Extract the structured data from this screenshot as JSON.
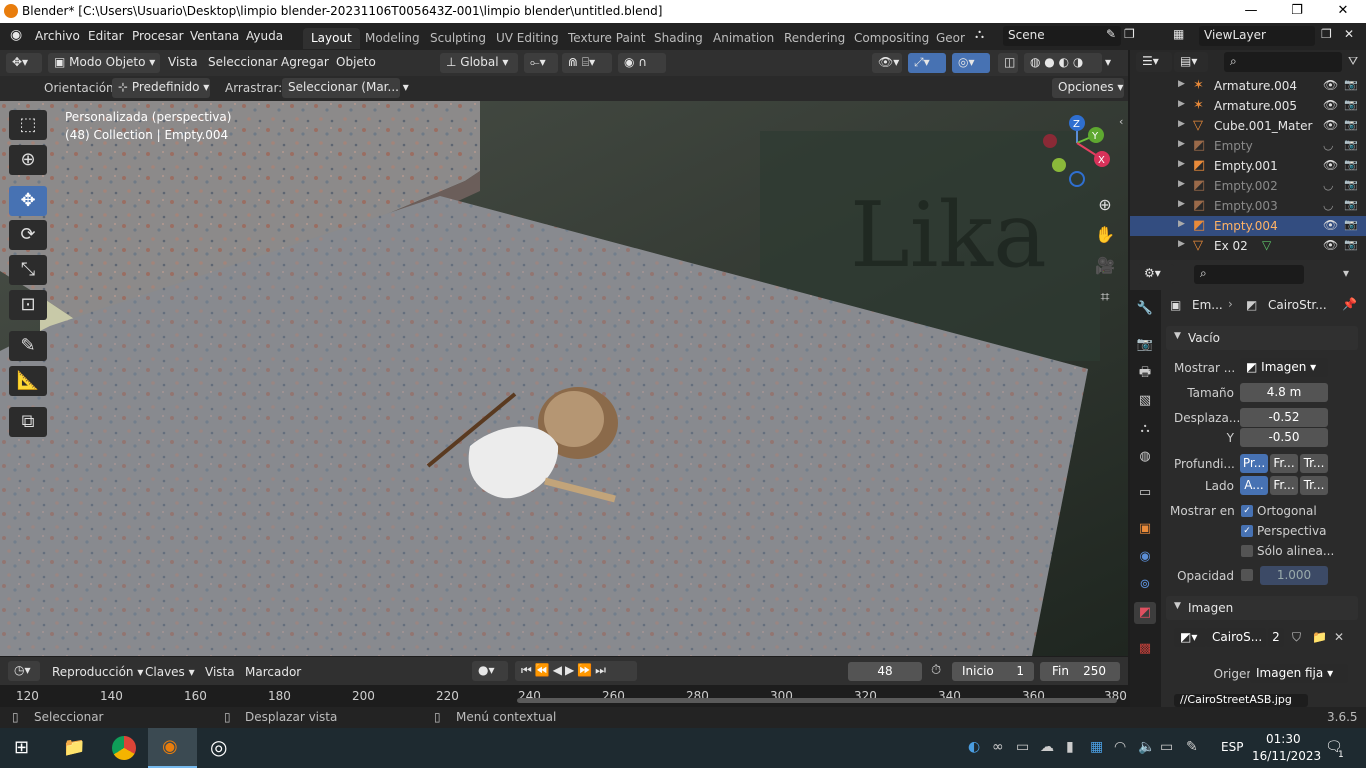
{
  "window": {
    "title": "Blender* [C:\\Users\\Usuario\\Desktop\\limpio blender-20231106T005643Z-001\\limpio blender\\untitled.blend]",
    "minimize": "—",
    "maximize": "❐",
    "close": "✕"
  },
  "menu": {
    "items": [
      "Archivo",
      "Editar",
      "Procesar",
      "Ventana",
      "Ayuda"
    ],
    "workspaces": [
      "Layout",
      "Modeling",
      "Sculpting",
      "UV Editing",
      "Texture Paint",
      "Shading",
      "Animation",
      "Rendering",
      "Compositing",
      "Geor"
    ],
    "active_workspace": "Layout",
    "scene": "Scene",
    "view_layer": "ViewLayer"
  },
  "viewport_header": {
    "mode": "Modo Objeto",
    "menus": [
      "Vista",
      "Seleccionar",
      "Agregar",
      "Objeto"
    ],
    "transform_orientation": "Global",
    "orientation_label": "Orientación:",
    "orientation_value": "Predefinido",
    "drag_label": "Arrastrar:",
    "drag_value": "Seleccionar (Mar...",
    "options": "Opciones"
  },
  "viewport": {
    "view_name": "Personalizada (perspectiva)",
    "collection_info": "(48) Collection | Empty.004",
    "gizmo_axes": [
      "Z",
      "Y",
      "X"
    ]
  },
  "outliner": {
    "search_placeholder": "",
    "rows": [
      {
        "name": "Armature.004",
        "icon": "armature-icon",
        "dim": false,
        "selected": false
      },
      {
        "name": "Armature.005",
        "icon": "armature-icon",
        "dim": false,
        "selected": false
      },
      {
        "name": "Cube.001_Mater",
        "icon": "mesh-icon",
        "dim": false,
        "selected": false
      },
      {
        "name": "Empty",
        "icon": "empty-image-icon",
        "dim": true,
        "selected": false
      },
      {
        "name": "Empty.001",
        "icon": "empty-image-icon",
        "dim": false,
        "selected": false
      },
      {
        "name": "Empty.002",
        "icon": "empty-image-icon",
        "dim": true,
        "selected": false
      },
      {
        "name": "Empty.003",
        "icon": "empty-image-icon",
        "dim": true,
        "selected": false
      },
      {
        "name": "Empty.004",
        "icon": "empty-image-icon",
        "dim": false,
        "selected": true
      },
      {
        "name": "Ex 02",
        "icon": "mesh-icon",
        "dim": false,
        "selected": false
      }
    ]
  },
  "properties": {
    "breadcrumb_object": "Em...",
    "breadcrumb_data": "CairoStr...",
    "panel_empty": "Vacío",
    "show_label": "Mostrar ...",
    "show_value": "Imagen",
    "size_label": "Tamaño",
    "size_value": "4.8 m",
    "offset_label": "Desplaza...",
    "offset_x": "-0.52",
    "offset_y_label": "Y",
    "offset_y": "-0.50",
    "depth_label": "Profundi...",
    "depth_options": [
      "Pr...",
      "Fr...",
      "Tr..."
    ],
    "side_label": "Lado",
    "side_options": [
      "A...",
      "Fr...",
      "Tr..."
    ],
    "show_in_label": "Mostrar en",
    "show_in_options": [
      {
        "label": "Ortogonal",
        "checked": true
      },
      {
        "label": "Perspectiva",
        "checked": true
      },
      {
        "label": "Sólo alinea...",
        "checked": false
      }
    ],
    "opacity_label": "Opacidad",
    "opacity_value": "1.000",
    "panel_image": "Imagen",
    "image_name": "CairoS...",
    "image_users": "2",
    "source_label": "Origen",
    "source_value": "Imagen fija",
    "filepath": "//CairoStreetASB.jpg"
  },
  "timeline": {
    "menus": [
      "Reproducción",
      "Claves",
      "Vista",
      "Marcador"
    ],
    "current_frame": "48",
    "start_label": "Inicio",
    "start_value": "1",
    "end_label": "Fin",
    "end_value": "250",
    "ruler": [
      "120",
      "140",
      "160",
      "180",
      "200",
      "220",
      "240",
      "260",
      "280",
      "300",
      "320",
      "340",
      "360",
      "380"
    ]
  },
  "statusbar": {
    "select": "Seleccionar",
    "pan": "Desplazar vista",
    "context_menu": "Menú contextual",
    "version": "3.6.5"
  },
  "taskbar": {
    "language": "ESP",
    "time": "01:30",
    "date": "16/11/2023",
    "notifications": "1"
  },
  "colors": {
    "accent": "#4772b3",
    "selected_row": "#334d80",
    "orange": "#e88a3a"
  }
}
